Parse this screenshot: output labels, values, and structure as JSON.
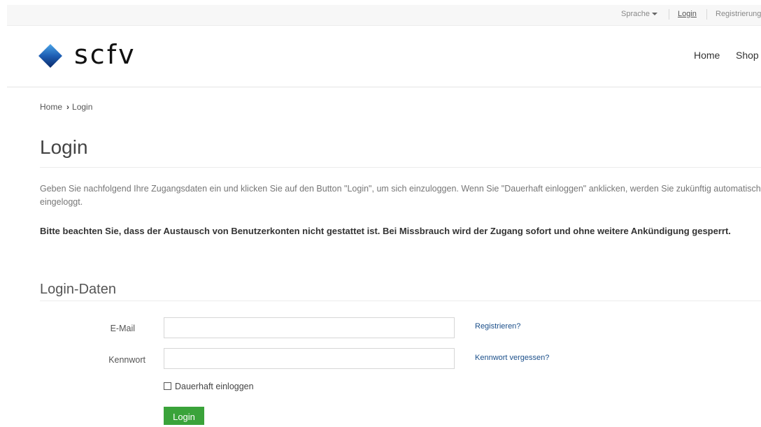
{
  "topbar": {
    "language_label": "Sprache",
    "login_label": "Login",
    "register_label": "Registrierung"
  },
  "header": {
    "logo_text": "scfv",
    "nav": [
      "Home",
      "Shop"
    ]
  },
  "breadcrumb": {
    "home": "Home",
    "current": "Login"
  },
  "page": {
    "title": "Login",
    "intro": "Geben Sie nachfolgend Ihre Zugangsdaten ein und klicken Sie auf den Button \"Login\", um sich einzuloggen. Wenn Sie \"Dauerhaft einloggen\" anklicken, werden Sie zukünftig automatisch eingeloggt.",
    "warning": "Bitte beachten Sie, dass der Austausch von Benutzerkonten nicht gestattet ist. Bei Missbrauch wird der Zugang sofort und ohne weitere Ankündigung gesperrt."
  },
  "form": {
    "section_title": "Login-Daten",
    "email_label": "E-Mail",
    "email_value": "",
    "password_label": "Kennwort",
    "password_value": "",
    "register_link": "Registrieren?",
    "forgot_link": "Kennwort vergessen?",
    "remember_label": "Dauerhaft einloggen",
    "remember_checked": false,
    "submit_label": "Login"
  },
  "colors": {
    "accent_green": "#3aa33a",
    "link_blue": "#1b4f8a",
    "logo_blue": "#1e5fb4"
  }
}
